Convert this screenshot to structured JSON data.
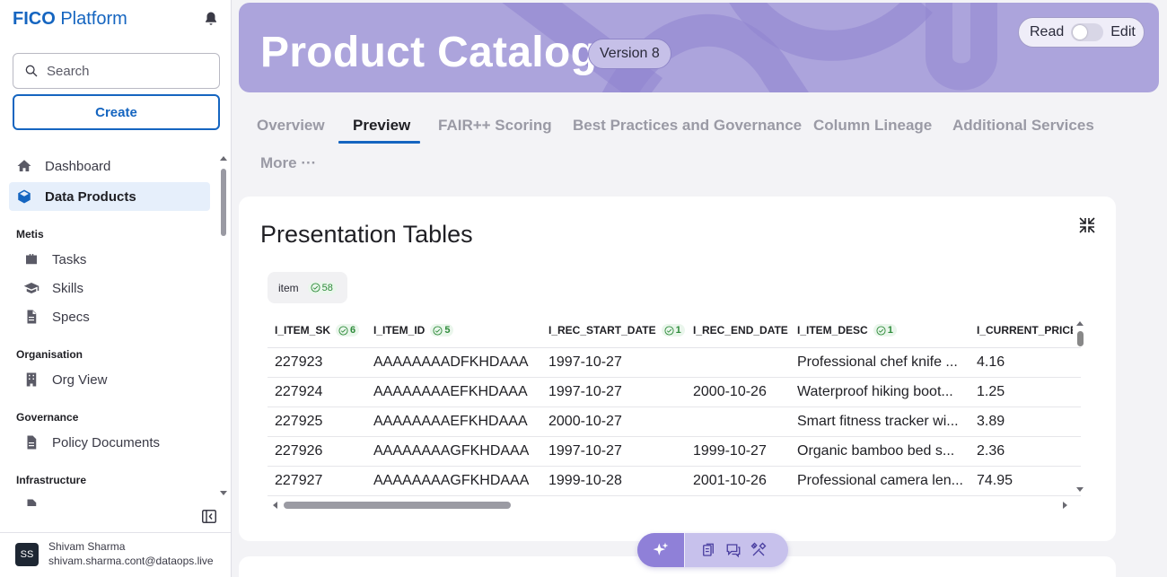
{
  "sidebar": {
    "brand_bold": "FICO",
    "brand_rest": "Platform",
    "search_placeholder": "Search",
    "create_label": "Create",
    "items": {
      "dashboard": "Dashboard",
      "data_products": "Data Products",
      "tasks": "Tasks",
      "skills": "Skills",
      "specs": "Specs",
      "org_view": "Org View",
      "policy_documents": "Policy Documents"
    },
    "sections": {
      "metis": "Metis",
      "organisation": "Organisation",
      "governance": "Governance",
      "infrastructure": "Infrastructure"
    },
    "user": {
      "initials": "SS",
      "name": "Shivam Sharma",
      "email": "shivam.sharma.cont@dataops.live"
    }
  },
  "banner": {
    "title": "Product Catalog",
    "version": "Version 8",
    "mode_read": "Read",
    "mode_edit": "Edit"
  },
  "tabs": {
    "overview": "Overview",
    "preview": "Preview",
    "fair": "FAIR++ Scoring",
    "best_practices": "Best Practices and Governance",
    "lineage": "Column Lineage",
    "additional": "Additional Services",
    "more": "More ···"
  },
  "card": {
    "title": "Presentation Tables",
    "table_chip": {
      "name": "item",
      "count": "58"
    },
    "columns": [
      {
        "name": "I_ITEM_SK",
        "badge": "6"
      },
      {
        "name": "I_ITEM_ID",
        "badge": "5"
      },
      {
        "name": "I_REC_START_DATE",
        "badge": "1"
      },
      {
        "name": "I_REC_END_DATE",
        "badge": ""
      },
      {
        "name": "I_ITEM_DESC",
        "badge": "1"
      },
      {
        "name": "I_CURRENT_PRICE",
        "badge": ""
      }
    ],
    "rows": [
      [
        "227923",
        "AAAAAAAADFKHDAAA",
        "1997-10-27",
        "",
        "Professional chef knife ...",
        "4.16"
      ],
      [
        "227924",
        "AAAAAAAAEFKHDAAA",
        "1997-10-27",
        "2000-10-26",
        "Waterproof hiking boot...",
        "1.25"
      ],
      [
        "227925",
        "AAAAAAAAEFKHDAAA",
        "2000-10-27",
        "",
        "Smart fitness tracker wi...",
        "3.89"
      ],
      [
        "227926",
        "AAAAAAAAGFKHDAAA",
        "1997-10-27",
        "1999-10-27",
        "Organic bamboo bed s...",
        "2.36"
      ],
      [
        "227927",
        "AAAAAAAAGFKHDAAA",
        "1999-10-28",
        "2001-10-26",
        "Professional camera len...",
        "74.95"
      ]
    ]
  },
  "colors": {
    "accent": "#1565c0",
    "banner": "#aca4dc",
    "badge_green": "#2e8b3a"
  }
}
